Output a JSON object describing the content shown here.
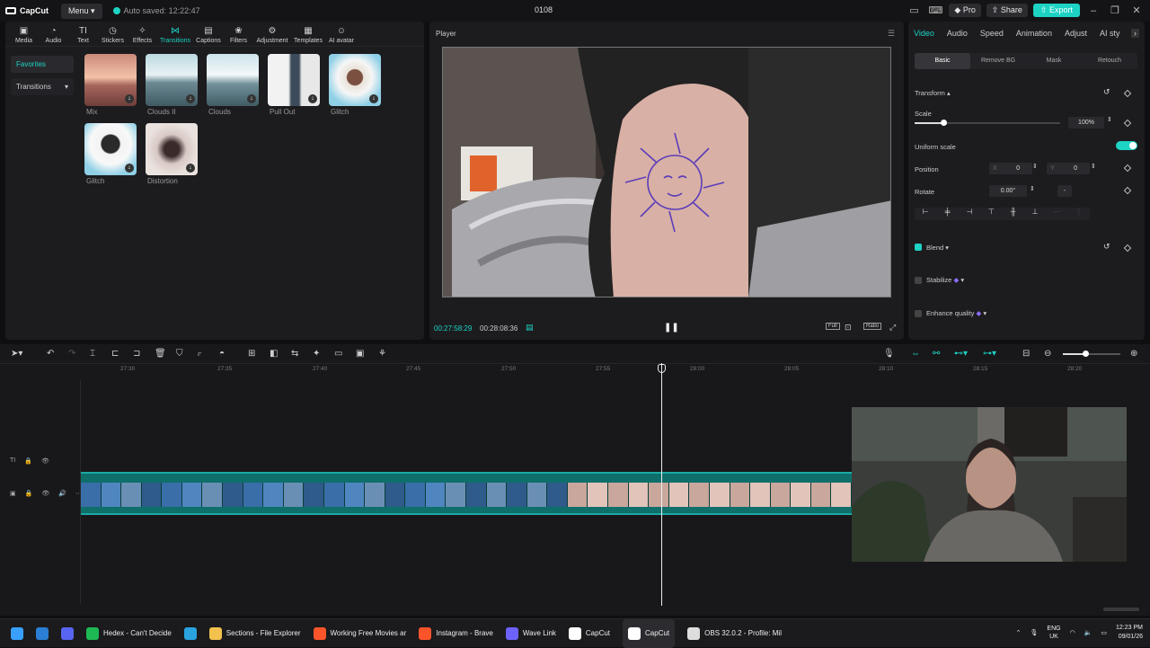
{
  "titlebar": {
    "app_name": "CapCut",
    "menu_label": "Menu",
    "autosave": "Auto saved: 12:22:47",
    "project_title": "0108",
    "pro_label": "Pro",
    "share_label": "Share",
    "export_label": "Export"
  },
  "toolbar": {
    "tabs": [
      {
        "label": "Media",
        "icon": "media-icon"
      },
      {
        "label": "Audio",
        "icon": "audio-icon"
      },
      {
        "label": "Text",
        "icon": "text-icon"
      },
      {
        "label": "Stickers",
        "icon": "stickers-icon"
      },
      {
        "label": "Effects",
        "icon": "effects-icon"
      },
      {
        "label": "Transitions",
        "icon": "transitions-icon"
      },
      {
        "label": "Captions",
        "icon": "captions-icon"
      },
      {
        "label": "Filters",
        "icon": "filters-icon"
      },
      {
        "label": "Adjustment",
        "icon": "adjustment-icon"
      },
      {
        "label": "Templates",
        "icon": "templates-icon"
      },
      {
        "label": "AI avatar",
        "icon": "ai-avatar-icon"
      }
    ],
    "active_tab": "Transitions"
  },
  "sidenav": {
    "favorites": "Favorites",
    "transitions": "Transitions"
  },
  "transitions": [
    {
      "label": "Mix"
    },
    {
      "label": "Clouds II"
    },
    {
      "label": "Clouds"
    },
    {
      "label": "Pull Out"
    },
    {
      "label": "Glitch"
    },
    {
      "label": "Glitch"
    },
    {
      "label": "Distortion"
    }
  ],
  "player": {
    "title": "Player",
    "current_time": "00:27:58:29",
    "total_time": "00:28:08:36",
    "full_label": "Full",
    "ratio_label": "Ratio"
  },
  "props": {
    "tabs": [
      "Video",
      "Audio",
      "Speed",
      "Animation",
      "Adjust",
      "AI sty"
    ],
    "subtabs": [
      "Basic",
      "Remove BG",
      "Mask",
      "Retouch"
    ],
    "transform": "Transform",
    "scale_label": "Scale",
    "scale_value": "100%",
    "scale_level": 0.2,
    "uniform_scale": "Uniform scale",
    "position_label": "Position",
    "pos_x_label": "X",
    "pos_x": "0",
    "pos_y_label": "Y",
    "pos_y": "0",
    "rotate_label": "Rotate",
    "rotate_value": "0.00°",
    "rotate_dash": "-",
    "blend": "Blend",
    "stabilize": "Stabilize",
    "enhance_quality": "Enhance quality"
  },
  "timeline": {
    "ruler": [
      "27:30",
      "27:35",
      "27:40",
      "27:45",
      "27:50",
      "27:55",
      "28:00",
      "28:05",
      "28:10",
      "28:15",
      "28:20"
    ]
  },
  "taskbar": {
    "items": [
      {
        "label": "",
        "icon": "windows-start-icon",
        "color": "#3aa0ff"
      },
      {
        "label": "",
        "icon": "outlook-icon",
        "color": "#2a7fd4"
      },
      {
        "label": "",
        "icon": "discord-icon",
        "color": "#5865f2"
      },
      {
        "label": "Hedex - Can't Decide",
        "icon": "spotify-icon",
        "color": "#1db954"
      },
      {
        "label": "",
        "icon": "telegram-icon",
        "color": "#2aa3df"
      },
      {
        "label": "Sections - File Explorer",
        "icon": "folder-icon",
        "color": "#f2c14e"
      },
      {
        "label": "Working Free Movies ar",
        "icon": "brave-icon",
        "color": "#fb542b"
      },
      {
        "label": "Instagram - Brave",
        "icon": "brave-icon",
        "color": "#fb542b"
      },
      {
        "label": "Wave Link",
        "icon": "wave-link-icon",
        "color": "#6c63ff"
      },
      {
        "label": "CapCut",
        "icon": "capcut-icon",
        "color": "#ffffff"
      },
      {
        "label": "CapCut",
        "icon": "capcut-icon",
        "color": "#ffffff"
      },
      {
        "label": "OBS 32.0.2 - Profile: Mil",
        "icon": "obs-icon",
        "color": "#dddddd"
      }
    ],
    "lang": "ENG",
    "region": "UK",
    "time": "12:23 PM",
    "date": "09/01/26"
  },
  "colors": {
    "accent": "#1dd3c4",
    "clip": "#0e6f6b"
  }
}
